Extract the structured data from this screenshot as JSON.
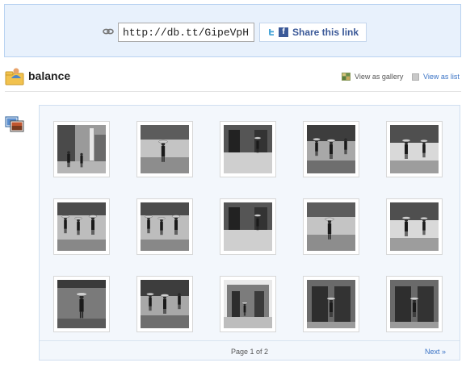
{
  "share": {
    "link_value": "http://db.tt/GipeVpH",
    "button_label": "Share this link",
    "icons": [
      "link-icon",
      "twitter-icon",
      "facebook-icon"
    ]
  },
  "folder": {
    "title": "balance",
    "view_gallery_label": "View as gallery",
    "view_list_label": "View as list"
  },
  "gallery": {
    "photos": [
      {
        "name": "photo-1",
        "style": "street"
      },
      {
        "name": "photo-2",
        "style": "carrier"
      },
      {
        "name": "photo-3",
        "style": "doorway"
      },
      {
        "name": "photo-4",
        "style": "crowd"
      },
      {
        "name": "photo-5",
        "style": "market"
      },
      {
        "name": "photo-6",
        "style": "walkers"
      },
      {
        "name": "photo-7",
        "style": "walkers"
      },
      {
        "name": "photo-8",
        "style": "doorway"
      },
      {
        "name": "photo-9",
        "style": "carrier"
      },
      {
        "name": "photo-10",
        "style": "market"
      },
      {
        "name": "photo-11",
        "style": "alley"
      },
      {
        "name": "photo-12",
        "style": "crowd"
      },
      {
        "name": "photo-13",
        "style": "building"
      },
      {
        "name": "photo-14",
        "style": "doors"
      },
      {
        "name": "photo-15",
        "style": "doors"
      }
    ]
  },
  "pagination": {
    "page_label": "Page 1 of 2",
    "next_label": "Next »"
  },
  "colors": {
    "accent_blue": "#3a73c5",
    "share_bg": "#e8f1fc",
    "facebook": "#3b5998",
    "twitter": "#4aa6d8"
  }
}
